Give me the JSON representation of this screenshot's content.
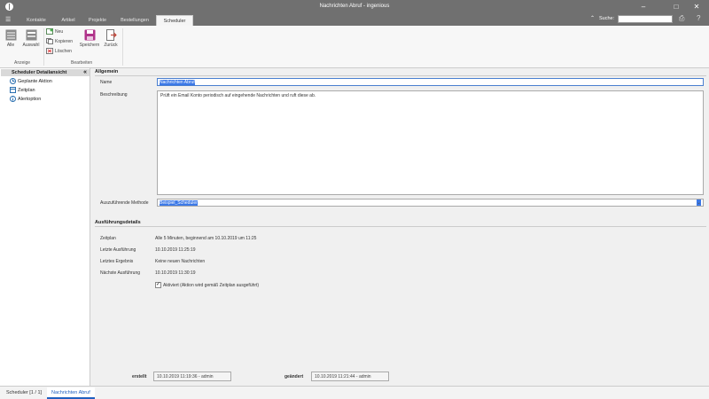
{
  "window": {
    "title": "Nachrichten Abruf - ingenious",
    "minimize": "–",
    "maximize": "□",
    "close": "✕"
  },
  "tabs": {
    "menu": "☰",
    "items": [
      "Kontakte",
      "Artikel",
      "Projekte",
      "Bestellungen",
      "Scheduler"
    ],
    "active": "Scheduler",
    "search_label": "Suche:",
    "search_value": ""
  },
  "ribbon": {
    "alle": "Alle",
    "auswahl": "Auswahl",
    "neu": "Neu",
    "kopieren": "Kopieren",
    "loeschen": "Löschen",
    "speichern": "Speichern",
    "zurueck": "Zurück",
    "group_anzeige": "Anzeige",
    "group_bearbeiten": "Bearbeiten"
  },
  "sidebar": {
    "header": "Scheduler Detailansicht",
    "items": [
      "Geplante Aktion",
      "Zeitplan",
      "Alertoption"
    ]
  },
  "general": {
    "title": "Allgemein",
    "name_label": "Name",
    "name_value": "Nachrichten Abruf",
    "desc_label": "Beschreibung",
    "desc_value": "Prüft ein Email Konto periodisch auf eingehende Nachrichten und ruft diese ab.",
    "method_label": "Auszuführende Methode",
    "method_value": "Beispiel_Scheduler"
  },
  "details": {
    "title": "Ausführungsdetails",
    "rows": [
      {
        "label": "Zeitplan",
        "value": "Alle 5 Minuten, beginnend am 10.10.2019 um 11:25"
      },
      {
        "label": "Letzte Ausführung",
        "value": "10.10.2019 11:25:19"
      },
      {
        "label": "Letztes Ergebnis",
        "value": "Keine neuen Nachrichten"
      },
      {
        "label": "Nächste Ausführung",
        "value": "10.10.2019 11:30:19"
      }
    ],
    "active_checked": true,
    "active_label": "Aktiviert (Aktion wird gemäß Zeitplan ausgeführt)"
  },
  "footer": {
    "created_label": "erstellt",
    "created_value": "10.10.2019 11:19:36 - admin",
    "changed_label": "geändert",
    "changed_value": "10.10.2019 11:21:44 - admin"
  },
  "statusbar": {
    "tabs": [
      "Scheduler [1 / 1]",
      "Nachrichten Abruf"
    ],
    "active": "Nachrichten Abruf"
  },
  "colors": {
    "titlebar": "#707070",
    "selection": "#3b78e7",
    "active_tab_text": "#2060c0"
  }
}
